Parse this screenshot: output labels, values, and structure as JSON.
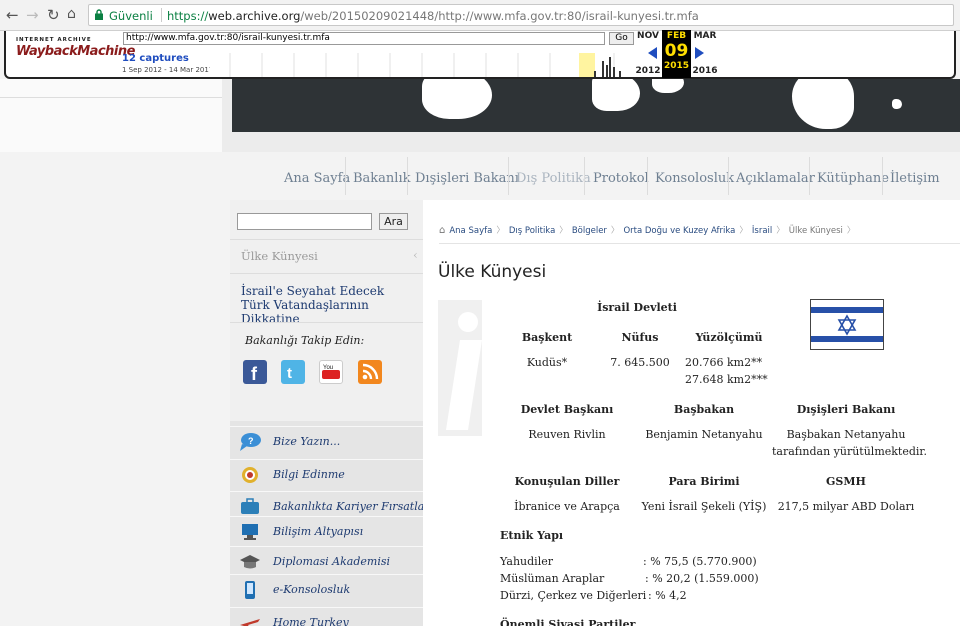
{
  "browser": {
    "back_icon": "back-arrow-icon",
    "forward_icon": "forward-arrow-icon",
    "reload_icon": "reload-icon",
    "home_icon": "home-icon",
    "secure_label": "Güvenli",
    "url_scheme": "https://",
    "url_host": "web.archive.org",
    "url_path": "/web/20150209021448/http://www.mfa.gov.tr:80/israil-kunyesi.tr.mfa"
  },
  "wayback": {
    "logo_top": "INTERNET ARCHIVE",
    "logo_main": "WaybackMachine",
    "url_value": "http://www.mfa.gov.tr:80/israil-kunyesi.tr.mfa",
    "go_label": "Go",
    "captures": "12 captures",
    "range": "1 Sep 2012 - 14 Mar 2017",
    "prev_month": "NOV",
    "prev_year": "2012",
    "cur_month": "FEB",
    "cur_day": "09",
    "cur_year": "2015",
    "next_month": "MAR",
    "next_year": "2016"
  },
  "nav": {
    "items": [
      "Ana Sayfa",
      "Bakanlık",
      "Dışişleri Bakanı",
      "Dış Politika",
      "Protokol",
      "Konsolosluk",
      "Açıklamalar",
      "Kütüphane",
      "İletişim"
    ]
  },
  "sidebar": {
    "search_placeholder": "",
    "search_button": "Ara",
    "section_title": "Ülke Künyesi",
    "link": "İsrail'e Seyahat Edecek Türk Vatandaşlarının Dikkatine",
    "follow_label": "Bakanlığı Takip Edin:",
    "social": [
      "facebook-icon",
      "twitter-icon",
      "youtube-icon",
      "rss-icon"
    ],
    "items": [
      {
        "label": "Bize Yazın...",
        "icon": "speech-bubble-icon"
      },
      {
        "label": "Bilgi Edinme",
        "icon": "bimer-icon"
      },
      {
        "label": "Bakanlıkta Kariyer Fırsatları",
        "icon": "briefcase-icon"
      },
      {
        "label": "Bilişim Altyapısı",
        "icon": "computer-icon"
      },
      {
        "label": "Diplomasi Akademisi",
        "icon": "graduation-cap-icon"
      },
      {
        "label": "e-Konsolosluk",
        "icon": "mobile-phone-icon"
      },
      {
        "label": "Home Turkey",
        "icon": "airplane-icon"
      }
    ]
  },
  "breadcrumb": [
    "Ana Sayfa",
    "Dış Politika",
    "Bölgeler",
    "Orta Doğu ve Kuzey Afrika",
    "İsrail",
    "Ülke Künyesi"
  ],
  "page": {
    "title": "Ülke Künyesi",
    "country_name": "İsrail Devleti",
    "flag_icon": "israel-flag-icon",
    "headers1": [
      "Başkent",
      "Nüfus",
      "Yüzölçümü"
    ],
    "values1": [
      "Kudüs*",
      "7. 645.500",
      "20.766 km2**",
      "27.648 km2***"
    ],
    "headers2": [
      "Devlet Başkanı",
      "Başbakan",
      "Dışişleri Bakanı"
    ],
    "values2": [
      "Reuven Rivlin",
      "Benjamin Netanyahu",
      "Başbakan Netanyahu",
      "tarafından yürütülmektedir."
    ],
    "headers3": [
      "Konuşulan Diller",
      "Para Birimi",
      "GSMH"
    ],
    "values3": [
      "İbranice ve Arapça",
      "Yeni İsrail Şekeli (YİŞ)",
      "217,5 milyar ABD Doları"
    ],
    "ethnic_title": "Etnik Yapı",
    "ethnic": [
      {
        "name": "Yahudiler",
        "value": ": % 75,5 (5.770.900)"
      },
      {
        "name": "Müslüman Araplar",
        "value": ": % 20,2 (1.559.000)"
      },
      {
        "name": "Dürzi, Çerkez ve Diğerleri",
        "value": ": % 4,2"
      }
    ],
    "next_title": "Önemli Siyasi Partiler"
  }
}
